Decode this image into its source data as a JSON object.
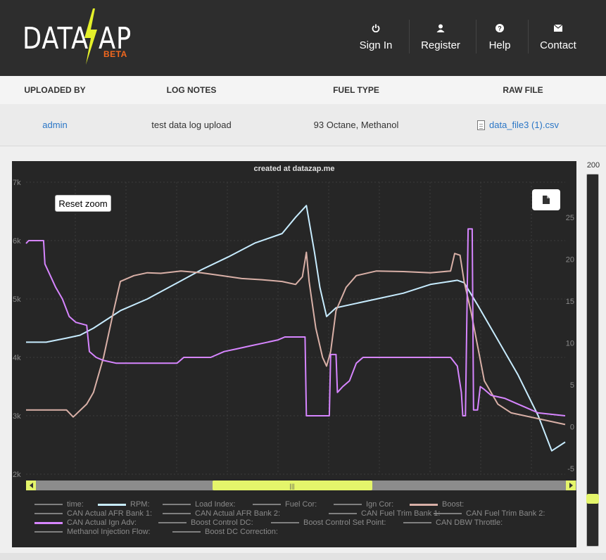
{
  "brand": {
    "left": "DATA",
    "right": "AP",
    "beta": "BETA",
    "bolt_color": "#e4f02a",
    "beta_color": "#f2681e"
  },
  "nav": [
    {
      "label": "Sign In",
      "icon": "power-icon"
    },
    {
      "label": "Register",
      "icon": "user-icon"
    },
    {
      "label": "Help",
      "icon": "help-icon"
    },
    {
      "label": "Contact",
      "icon": "envelope-icon"
    }
  ],
  "log_info": {
    "headers": [
      "UPLOADED BY",
      "LOG NOTES",
      "FUEL TYPE",
      "RAW FILE"
    ],
    "uploaded_by": "admin",
    "log_notes": "test data log upload",
    "fuel_type": "93 Octane, Methanol",
    "raw_file": "data_file3 (1).csv"
  },
  "chart": {
    "reset_zoom_label": "Reset zoom",
    "export_icon": "document-icon",
    "navigator_handle": "|||"
  },
  "side_slider": {
    "top_label": "200"
  },
  "chart_data": {
    "type": "line",
    "title": "created at datazap.me",
    "y_left": {
      "ticks": [
        "7k",
        "6k",
        "5k",
        "4k",
        "3k",
        "2k"
      ],
      "range": [
        2000,
        7000
      ]
    },
    "y_right": {
      "ticks": [
        "25",
        "20",
        "15",
        "10",
        "5",
        "0",
        "-5"
      ],
      "range": [
        -5,
        25
      ]
    },
    "grid": true,
    "legend_position": "bottom",
    "series": [
      {
        "name": "time:",
        "color": "#808080",
        "points": []
      },
      {
        "name": "RPM:",
        "color": "#c7ecff",
        "axis": "left",
        "points": [
          [
            0,
            4260
          ],
          [
            30,
            4260
          ],
          [
            60,
            4330
          ],
          [
            80,
            4380
          ],
          [
            100,
            4500
          ],
          [
            140,
            4800
          ],
          [
            180,
            5000
          ],
          [
            220,
            5250
          ],
          [
            260,
            5500
          ],
          [
            300,
            5720
          ],
          [
            340,
            5960
          ],
          [
            380,
            6120
          ],
          [
            400,
            6400
          ],
          [
            416,
            6600
          ],
          [
            428,
            5800
          ],
          [
            436,
            5200
          ],
          [
            446,
            4700
          ],
          [
            460,
            4850
          ],
          [
            480,
            4900
          ],
          [
            520,
            5000
          ],
          [
            560,
            5100
          ],
          [
            600,
            5250
          ],
          [
            640,
            5320
          ],
          [
            650,
            5280
          ],
          [
            670,
            4900
          ],
          [
            700,
            4300
          ],
          [
            730,
            3700
          ],
          [
            760,
            3000
          ],
          [
            780,
            2400
          ],
          [
            800,
            2550
          ]
        ]
      },
      {
        "name": "Load Index:",
        "color": "#808080",
        "points": []
      },
      {
        "name": "Fuel Cor:",
        "color": "#808080",
        "points": []
      },
      {
        "name": "Ign Cor:",
        "color": "#808080",
        "points": []
      },
      {
        "name": "Boost:",
        "color": "#d9b0a7",
        "axis": "left",
        "points": [
          [
            0,
            3100
          ],
          [
            60,
            3100
          ],
          [
            70,
            2980
          ],
          [
            90,
            3200
          ],
          [
            100,
            3400
          ],
          [
            115,
            4000
          ],
          [
            130,
            4800
          ],
          [
            140,
            5300
          ],
          [
            160,
            5400
          ],
          [
            180,
            5450
          ],
          [
            200,
            5440
          ],
          [
            230,
            5480
          ],
          [
            260,
            5450
          ],
          [
            290,
            5400
          ],
          [
            320,
            5350
          ],
          [
            350,
            5330
          ],
          [
            380,
            5300
          ],
          [
            400,
            5250
          ],
          [
            410,
            5380
          ],
          [
            416,
            5800
          ],
          [
            420,
            5300
          ],
          [
            430,
            4500
          ],
          [
            440,
            4000
          ],
          [
            446,
            3850
          ],
          [
            452,
            4100
          ],
          [
            460,
            4800
          ],
          [
            475,
            5200
          ],
          [
            490,
            5400
          ],
          [
            520,
            5480
          ],
          [
            560,
            5470
          ],
          [
            600,
            5450
          ],
          [
            630,
            5480
          ],
          [
            636,
            5780
          ],
          [
            644,
            5750
          ],
          [
            650,
            5300
          ],
          [
            660,
            4800
          ],
          [
            670,
            4200
          ],
          [
            680,
            3600
          ],
          [
            700,
            3200
          ],
          [
            720,
            3050
          ],
          [
            760,
            2950
          ],
          [
            800,
            2850
          ]
        ]
      },
      {
        "name": "CAN Actual AFR Bank 1:",
        "color": "#808080",
        "points": []
      },
      {
        "name": "CAN Actual AFR Bank 2:",
        "color": "#808080",
        "points": []
      },
      {
        "name": "CAN Fuel Trim Bank 1:",
        "color": "#808080",
        "points": []
      },
      {
        "name": "CAN Fuel Trim Bank 2:",
        "color": "#808080",
        "points": []
      },
      {
        "name": "CAN Actual Ign Adv:",
        "color": "#d685ff",
        "axis": "left",
        "points": [
          [
            0,
            5950
          ],
          [
            4,
            6000
          ],
          [
            26,
            6000
          ],
          [
            28,
            5600
          ],
          [
            36,
            5400
          ],
          [
            44,
            5200
          ],
          [
            54,
            5000
          ],
          [
            64,
            4700
          ],
          [
            74,
            4600
          ],
          [
            90,
            4550
          ],
          [
            94,
            4100
          ],
          [
            104,
            4000
          ],
          [
            114,
            3950
          ],
          [
            134,
            3900
          ],
          [
            194,
            3900
          ],
          [
            224,
            3900
          ],
          [
            234,
            4000
          ],
          [
            274,
            4000
          ],
          [
            294,
            4100
          ],
          [
            314,
            4150
          ],
          [
            334,
            4200
          ],
          [
            354,
            4250
          ],
          [
            374,
            4300
          ],
          [
            384,
            4350
          ],
          [
            414,
            4350
          ],
          [
            416,
            3000
          ],
          [
            450,
            3000
          ],
          [
            452,
            4050
          ],
          [
            460,
            4050
          ],
          [
            462,
            3400
          ],
          [
            470,
            3500
          ],
          [
            480,
            3600
          ],
          [
            490,
            3900
          ],
          [
            500,
            4000
          ],
          [
            510,
            4000
          ],
          [
            630,
            4000
          ],
          [
            640,
            3850
          ],
          [
            646,
            3400
          ],
          [
            648,
            3000
          ],
          [
            652,
            3000
          ],
          [
            656,
            6200
          ],
          [
            662,
            6200
          ],
          [
            664,
            3100
          ],
          [
            670,
            3100
          ],
          [
            674,
            3500
          ],
          [
            680,
            3450
          ],
          [
            690,
            3350
          ],
          [
            710,
            3300
          ],
          [
            730,
            3200
          ],
          [
            740,
            3150
          ],
          [
            760,
            3050
          ],
          [
            800,
            3000
          ]
        ]
      },
      {
        "name": "Boost Control DC:",
        "color": "#808080",
        "points": []
      },
      {
        "name": "Boost Control Set Point:",
        "color": "#808080",
        "points": []
      },
      {
        "name": "CAN DBW Throttle:",
        "color": "#808080",
        "points": []
      },
      {
        "name": "Methanol Injection Flow:",
        "color": "#808080",
        "points": []
      },
      {
        "name": "Boost DC Correction:",
        "color": "#808080",
        "points": []
      }
    ]
  }
}
